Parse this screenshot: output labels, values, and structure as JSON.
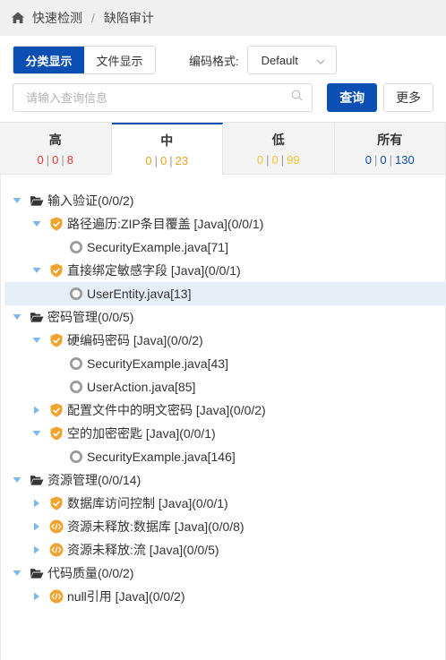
{
  "breadcrumb": {
    "root": "快速检测",
    "separator": "/",
    "current": "缺陷审计"
  },
  "toolbar": {
    "view_buttons": [
      "分类显示",
      "文件显示"
    ],
    "active_view": 0,
    "encoding_label": "编码格式:",
    "encoding_value": "Default"
  },
  "search": {
    "placeholder": "请输入查询信息",
    "query_label": "查询",
    "more_label": "更多"
  },
  "colors": {
    "accent": "#0b4fb4",
    "high": "#e03c31",
    "medium": "#e8a020",
    "low": "#f2c335",
    "all": "#0b4fb4",
    "tree_arrow": "#7fb8e8",
    "shield": "#f0a32e",
    "code_icon": "#f0a32e",
    "file_dot": "#9a9a9a",
    "folder": "#333333"
  },
  "tabs": [
    {
      "title": "高",
      "c1": "0",
      "c2": "0",
      "c3": "8",
      "color": "#e03c31"
    },
    {
      "title": "中",
      "c1": "0",
      "c2": "0",
      "c3": "23",
      "color": "#e8a020"
    },
    {
      "title": "低",
      "c1": "0",
      "c2": "0",
      "c3": "99",
      "color": "#f2c335"
    },
    {
      "title": "所有",
      "c1": "0",
      "c2": "0",
      "c3": "130",
      "color": "#0b4fb4"
    }
  ],
  "active_tab": 1,
  "tree": [
    {
      "depth": 0,
      "icon": "folder-open-icon",
      "arrow": "down",
      "label": "输入验证(0/0/2)"
    },
    {
      "depth": 1,
      "icon": "shield-icon",
      "arrow": "down",
      "label": "路径遍历:ZIP条目覆盖 [Java](0/0/1)"
    },
    {
      "depth": 2,
      "icon": "file-dot-icon",
      "arrow": "none",
      "label": "SecurityExample.java[71]"
    },
    {
      "depth": 1,
      "icon": "shield-icon",
      "arrow": "down",
      "label": "直接绑定敏感字段 [Java](0/0/1)"
    },
    {
      "depth": 2,
      "icon": "file-dot-icon",
      "arrow": "none",
      "label": "UserEntity.java[13]",
      "selected": true
    },
    {
      "depth": 0,
      "icon": "folder-open-icon",
      "arrow": "down",
      "label": "密码管理(0/0/5)"
    },
    {
      "depth": 1,
      "icon": "shield-icon",
      "arrow": "down",
      "label": "硬编码密码 [Java](0/0/2)"
    },
    {
      "depth": 2,
      "icon": "file-dot-icon",
      "arrow": "none",
      "label": "SecurityExample.java[43]"
    },
    {
      "depth": 2,
      "icon": "file-dot-icon",
      "arrow": "none",
      "label": "UserAction.java[85]"
    },
    {
      "depth": 1,
      "icon": "shield-icon",
      "arrow": "right",
      "label": "配置文件中的明文密码 [Java](0/0/2)"
    },
    {
      "depth": 1,
      "icon": "shield-icon",
      "arrow": "down",
      "label": "空的加密密匙 [Java](0/0/1)"
    },
    {
      "depth": 2,
      "icon": "file-dot-icon",
      "arrow": "none",
      "label": "SecurityExample.java[146]"
    },
    {
      "depth": 0,
      "icon": "folder-open-icon",
      "arrow": "down",
      "label": "资源管理(0/0/14)"
    },
    {
      "depth": 1,
      "icon": "shield-icon",
      "arrow": "right",
      "label": "数据库访问控制 [Java](0/0/1)"
    },
    {
      "depth": 1,
      "icon": "code-icon",
      "arrow": "right",
      "label": "资源未释放:数据库 [Java](0/0/8)"
    },
    {
      "depth": 1,
      "icon": "code-icon",
      "arrow": "right",
      "label": "资源未释放:流 [Java](0/0/5)"
    },
    {
      "depth": 0,
      "icon": "folder-open-icon",
      "arrow": "down",
      "label": "代码质量(0/0/2)"
    },
    {
      "depth": 1,
      "icon": "code-icon",
      "arrow": "right",
      "label": "null引用 [Java](0/0/2)"
    }
  ]
}
